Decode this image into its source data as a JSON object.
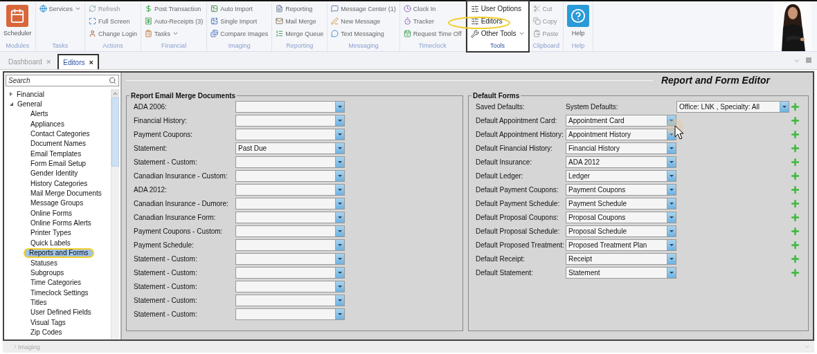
{
  "ribbon": {
    "groups": [
      {
        "label": "Modules",
        "highlighted": false,
        "items": [
          {
            "kind": "large",
            "label": "Scheduler",
            "disabled": false,
            "menu": false
          }
        ]
      },
      {
        "label": "Tasks",
        "highlighted": false,
        "items": [
          {
            "kind": "small",
            "label": "Services",
            "disabled": false,
            "menu": true
          }
        ]
      },
      {
        "label": "Actions",
        "highlighted": false,
        "items": [
          {
            "kind": "small",
            "label": "Refresh",
            "disabled": true,
            "menu": false
          },
          {
            "kind": "small",
            "label": "Full Screen",
            "disabled": false,
            "menu": false
          },
          {
            "kind": "small",
            "label": "Change Login",
            "disabled": false,
            "menu": false
          }
        ]
      },
      {
        "label": "Financial",
        "highlighted": false,
        "items": [
          {
            "kind": "small",
            "label": "Post Transaction",
            "disabled": false,
            "menu": false
          },
          {
            "kind": "small",
            "label": "Auto-Receipts (3)",
            "disabled": false,
            "menu": false
          },
          {
            "kind": "small",
            "label": "Tasks",
            "disabled": false,
            "menu": true
          }
        ]
      },
      {
        "label": "Imaging",
        "highlighted": false,
        "items": [
          {
            "kind": "small",
            "label": "Auto Import",
            "disabled": false,
            "menu": false
          },
          {
            "kind": "small",
            "label": "Single Import",
            "disabled": false,
            "menu": false
          },
          {
            "kind": "small",
            "label": "Compare Images",
            "disabled": false,
            "menu": false
          }
        ]
      },
      {
        "label": "Reporting",
        "highlighted": false,
        "items": [
          {
            "kind": "small",
            "label": "Reporting",
            "disabled": false,
            "menu": false
          },
          {
            "kind": "small",
            "label": "Mail Merge",
            "disabled": false,
            "menu": false
          },
          {
            "kind": "small",
            "label": "Merge Queue",
            "disabled": false,
            "menu": false
          }
        ]
      },
      {
        "label": "Messaging",
        "highlighted": false,
        "items": [
          {
            "kind": "small",
            "label": "Message Center (1)",
            "disabled": false,
            "menu": false
          },
          {
            "kind": "small",
            "label": "New Message",
            "disabled": false,
            "menu": false
          },
          {
            "kind": "small",
            "label": "Text Messaging",
            "disabled": false,
            "menu": false
          }
        ]
      },
      {
        "label": "Timeclock",
        "highlighted": false,
        "items": [
          {
            "kind": "small",
            "label": "Clock In",
            "disabled": false,
            "menu": false
          },
          {
            "kind": "small",
            "label": "Tracker",
            "disabled": false,
            "menu": false
          },
          {
            "kind": "small",
            "label": "Request Time Off",
            "disabled": false,
            "menu": false
          }
        ]
      },
      {
        "label": "Tools",
        "highlighted": true,
        "items": [
          {
            "kind": "small",
            "label": "User Options",
            "disabled": false,
            "menu": false
          },
          {
            "kind": "small",
            "label": "Editors",
            "disabled": false,
            "menu": false
          },
          {
            "kind": "small",
            "label": "Other Tools",
            "disabled": false,
            "menu": true
          }
        ]
      },
      {
        "label": "Clipboard",
        "highlighted": false,
        "items": [
          {
            "kind": "small",
            "label": "Cut",
            "disabled": true,
            "menu": false
          },
          {
            "kind": "small",
            "label": "Copy",
            "disabled": true,
            "menu": false
          },
          {
            "kind": "small",
            "label": "Paste",
            "disabled": true,
            "menu": false
          }
        ]
      },
      {
        "label": "Help",
        "highlighted": false,
        "items": [
          {
            "kind": "large",
            "label": "Help",
            "disabled": false,
            "menu": false
          }
        ]
      }
    ]
  },
  "doc_tabs": [
    {
      "label": "Dashboard",
      "close": "×",
      "selected": false
    },
    {
      "label": "Editors",
      "close": "×",
      "selected": true
    }
  ],
  "sidebar": {
    "search": {
      "placeholder": "Search"
    },
    "tree": [
      {
        "label": "Financial",
        "expanded": false,
        "selected": false
      },
      {
        "label": "General",
        "expanded": true,
        "selected": false,
        "children": [
          {
            "label": "Alerts",
            "selected": false
          },
          {
            "label": "Appliances",
            "selected": false
          },
          {
            "label": "Contact Categories",
            "selected": false
          },
          {
            "label": "Document Names",
            "selected": false
          },
          {
            "label": "Email Templates",
            "selected": false
          },
          {
            "label": "Form Email Setup",
            "selected": false
          },
          {
            "label": "Gender Identity",
            "selected": false
          },
          {
            "label": "History Categories",
            "selected": false
          },
          {
            "label": "Mail Merge Documents",
            "selected": false
          },
          {
            "label": "Message Groups",
            "selected": false
          },
          {
            "label": "Online Forms",
            "selected": false
          },
          {
            "label": "Online Forms Alerts",
            "selected": false
          },
          {
            "label": "Printer Types",
            "selected": false
          },
          {
            "label": "Quick Labels",
            "selected": false
          },
          {
            "label": "Reports and Forms",
            "selected": true
          },
          {
            "label": "Statuses",
            "selected": false
          },
          {
            "label": "Subgroups",
            "selected": false
          },
          {
            "label": "Time Categories",
            "selected": false
          },
          {
            "label": "Timeclock Settings",
            "selected": false
          },
          {
            "label": "Titles",
            "selected": false
          },
          {
            "label": "User Defined Fields",
            "selected": false
          },
          {
            "label": "Visual Tags",
            "selected": false
          },
          {
            "label": "Zip Codes",
            "selected": false
          }
        ]
      }
    ],
    "bottom_group": {
      "label": "Imaging"
    }
  },
  "editor": {
    "title": "Report and Form Editor",
    "email_merge": {
      "title": "Report Email Merge Documents",
      "rows": [
        {
          "label": "ADA 2006:"
        },
        {
          "label": "Financial History:"
        },
        {
          "label": "Payment Coupons:"
        },
        {
          "label": "Statement:",
          "value": "Past Due"
        },
        {
          "label": "Statement - Custom:"
        },
        {
          "label": "Canadian Insurance - Custom:"
        },
        {
          "label": "ADA 2012:"
        },
        {
          "label": "Canadian Insurance - Dumore:"
        },
        {
          "label": "Canadian Insurance Form:"
        },
        {
          "label": "Payment Coupons - Custom:"
        },
        {
          "label": "Payment Schedule:"
        },
        {
          "label": "Statement - Custom:"
        },
        {
          "label": "Statement - Custom:"
        },
        {
          "label": "Statement - Custom:"
        },
        {
          "label": "Statement - Custom:"
        },
        {
          "label": "Statement - Custom:"
        }
      ]
    },
    "default_forms": {
      "title": "Default Forms",
      "saved_label": "Saved Defaults:",
      "system_label": "System Defaults:",
      "office": {
        "value": "Office: LNK , Specialty: All"
      },
      "rows": [
        {
          "label": "Default Appointment Card:",
          "value": "Appointment Card"
        },
        {
          "label": "Default Appointment History:",
          "value": "Appointment History"
        },
        {
          "label": "Default Financial History:",
          "value": "Financial History"
        },
        {
          "label": "Default Insurance:",
          "value": "ADA 2012"
        },
        {
          "label": "Default Ledger:",
          "value": "Ledger"
        },
        {
          "label": "Default Payment Coupons:",
          "value": "Payment Coupons"
        },
        {
          "label": "Default Payment Schedule:",
          "value": "Payment Schedule"
        },
        {
          "label": "Default Proposal Coupons:",
          "value": "Proposal Coupons"
        },
        {
          "label": "Default Proposal Schedule:",
          "value": "Proposal Schedule"
        },
        {
          "label": "Default Proposed Treatment:",
          "value": "Proposed Treatment Plan"
        },
        {
          "label": "Default Receipt:",
          "value": "Receipt"
        },
        {
          "label": "Default Statement:",
          "value": "Statement"
        }
      ]
    }
  }
}
